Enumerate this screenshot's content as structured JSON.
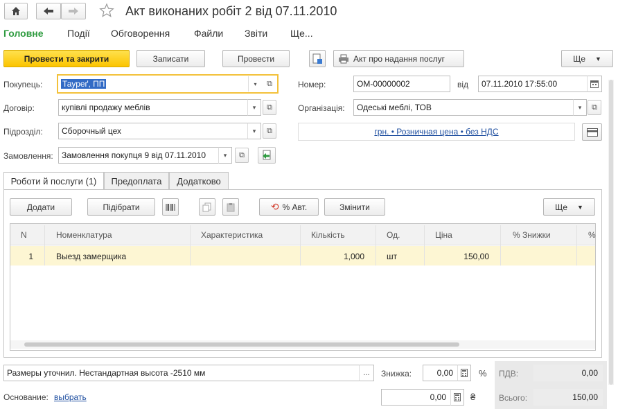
{
  "window": {
    "title": "Акт виконаних робіт 2 від 07.11.2010"
  },
  "icons": {
    "home": "home-icon",
    "back": "arrow-left-icon",
    "forward": "arrow-right-icon",
    "star": "star-icon"
  },
  "menu": [
    "Головне",
    "Події",
    "Обговорення",
    "Файли",
    "Звіти",
    "Ще..."
  ],
  "toolbar": {
    "post_close": "Провести та закрити",
    "save": "Записати",
    "post": "Провести",
    "print_act": "Акт про надання послуг",
    "more": "Ще"
  },
  "form": {
    "buyer_label": "Покупець:",
    "buyer_value": "Тауреґ, ПП",
    "contract_label": "Договір:",
    "contract_value": "купівлі продажу меблів",
    "dept_label": "Підрозділ:",
    "dept_value": "Сборочный цех",
    "order_label": "Замовлення:",
    "order_value": "Замовлення покупця 9 від 07.11.2010",
    "number_label": "Номер:",
    "number_value": "ОМ-00000002",
    "date_label": "від",
    "date_value": "07.11.2010 17:55:00",
    "org_label": "Організація:",
    "org_value": "Одеські меблі, ТОВ",
    "price_link": "грн. • Розничная цена • без НДС"
  },
  "tabs": [
    "Роботи й послуги (1)",
    "Предоплата",
    "Додатково"
  ],
  "table_toolbar": {
    "add": "Додати",
    "pick": "Підібрати",
    "auto": "% Авт.",
    "change": "Змінити",
    "more": "Ще"
  },
  "table": {
    "columns": [
      "N",
      "Номенклатура",
      "Характеристика",
      "Кількість",
      "Од.",
      "Ціна",
      "% Знижки",
      "%"
    ],
    "rows": [
      {
        "n": "1",
        "item": "Выезд замерщика",
        "char": "",
        "qty": "1,000",
        "unit": "шт",
        "price": "150,00",
        "discount": ""
      }
    ]
  },
  "footer": {
    "comment": "Размеры уточнил. Нестандартная высота -2510 мм",
    "comment_btn": "...",
    "discount_label": "Знижка:",
    "discount_value": "0,00",
    "percent_sign": "%",
    "amount_value": "0,00",
    "currency_sign": "₴",
    "vat_label": "ПДВ:",
    "vat_value": "0,00",
    "total_label": "Всього:",
    "total_value": "150,00",
    "basis_label": "Основание:",
    "basis_link": "выбрать"
  },
  "colors": {
    "accent_green": "#2e9b3f",
    "primary_yellow": "#fbc400",
    "focus_border": "#f3c13a",
    "row_highlight": "#fdf6d3",
    "link": "#1f4fa0"
  }
}
